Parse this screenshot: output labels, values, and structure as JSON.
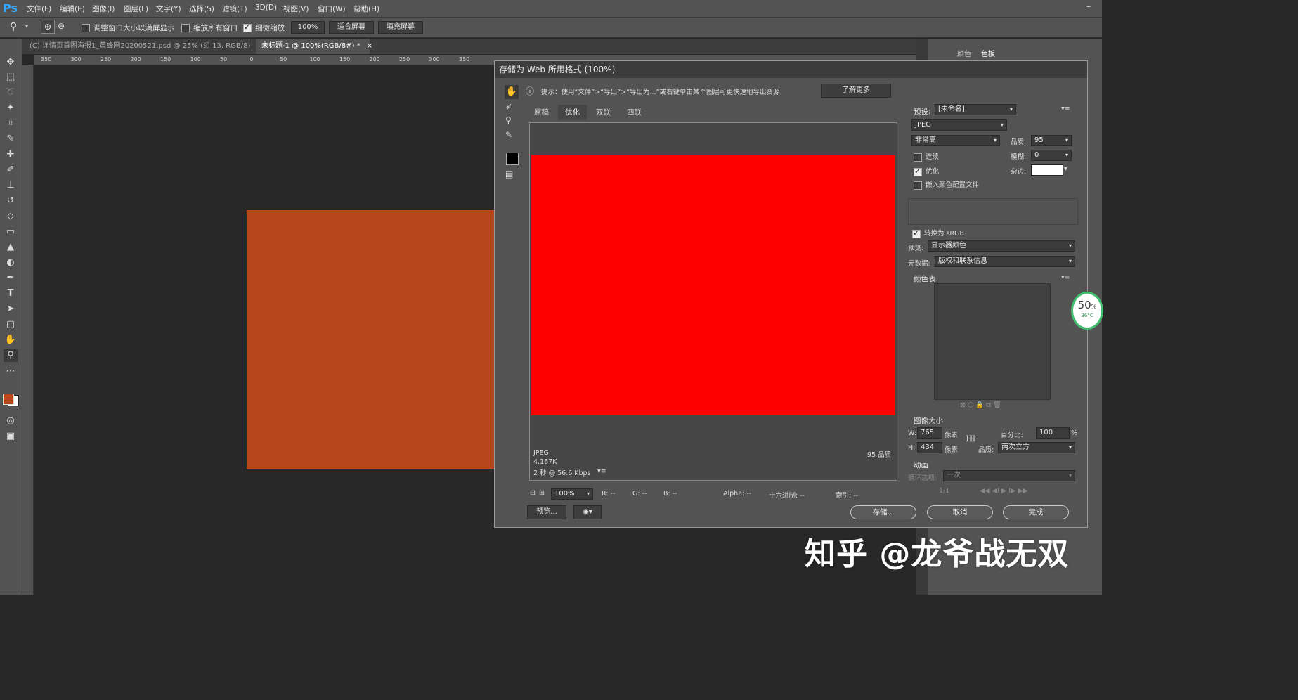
{
  "app": {
    "logo": "Ps"
  },
  "menu": [
    "文件(F)",
    "编辑(E)",
    "图像(I)",
    "图层(L)",
    "文字(Y)",
    "选择(S)",
    "滤镜(T)",
    "3D(D)",
    "视图(V)",
    "窗口(W)",
    "帮助(H)"
  ],
  "options": {
    "resize_windows": "调整窗口大小以满屏显示",
    "zoom_all": "缩放所有窗口",
    "scrubby_zoom": "细微缩放",
    "zoom_value": "100%",
    "fit_screen": "适合屏幕",
    "fill_screen": "填充屏幕"
  },
  "doc_tabs": [
    {
      "label": "(C) 详情页首图海报1_黄蜂网20200521.psd @ 25% (组 13, RGB/8)",
      "close": "×"
    },
    {
      "label": "未标题-1 @ 100%(RGB/8#) *",
      "close": "×"
    }
  ],
  "ruler_h": [
    "350",
    "300",
    "250",
    "200",
    "150",
    "100",
    "50",
    "0",
    "50",
    "100",
    "150",
    "200",
    "250",
    "300",
    "350"
  ],
  "colors": {
    "foreground": "#b7471a",
    "background": "#ffffff",
    "artboard": "#b7471a",
    "preview": "#ff0000"
  },
  "right_panel": {
    "tabs": [
      "颜色",
      "色板"
    ]
  },
  "dialog": {
    "title": "存储为 Web 所用格式 (100%)",
    "hint": "提示：使用“文件”>“导出”>“导出为...”或右键单击某个图层可更快速地导出资源",
    "learn_more": "了解更多",
    "tabs": [
      "原稿",
      "优化",
      "双联",
      "四联"
    ],
    "info": {
      "format": "JPEG",
      "size": "4.167K",
      "time": "2 秒 @ 56.6 Kbps",
      "quality_label": "95 品质"
    },
    "status": {
      "zoom": "100%",
      "r": "R: --",
      "g": "G: --",
      "b": "B: --",
      "alpha": "Alpha: --",
      "hex": "十六进制: --",
      "index": "索引: --"
    },
    "preview_btn": "预览...",
    "save_btn": "存储...",
    "cancel_btn": "取消",
    "done_btn": "完成",
    "settings": {
      "preset_label": "预设:",
      "preset_value": "[未命名]",
      "format_value": "JPEG",
      "quality_level": "非常高",
      "quality_label": "品质:",
      "quality_value": "95",
      "progressive": "连续",
      "blur_label": "模糊:",
      "blur_value": "0",
      "optimized": "优化",
      "matte_label": "杂边:",
      "embed_profile": "嵌入颜色配置文件",
      "convert_srgb": "转换为 sRGB",
      "preview_label": "预览:",
      "preview_value": "显示器颜色",
      "metadata_label": "元数据:",
      "metadata_value": "版权和联系信息",
      "color_table": "颜色表",
      "image_size": "图像大小",
      "w_label": "W:",
      "w_value": "765",
      "h_label": "H:",
      "h_value": "434",
      "px": "像素",
      "percent_label": "百分比:",
      "percent_value": "100",
      "percent_sign": "%",
      "resample_label": "品质:",
      "resample_value": "两次立方",
      "animation": "动画",
      "loop_label": "循环选项:",
      "loop_value": "一次",
      "frame_counter": "1/1"
    }
  },
  "gauge": {
    "value": "50",
    "unit": "%",
    "temp": "36°C"
  },
  "watermark": "知乎 @龙爷战无双"
}
